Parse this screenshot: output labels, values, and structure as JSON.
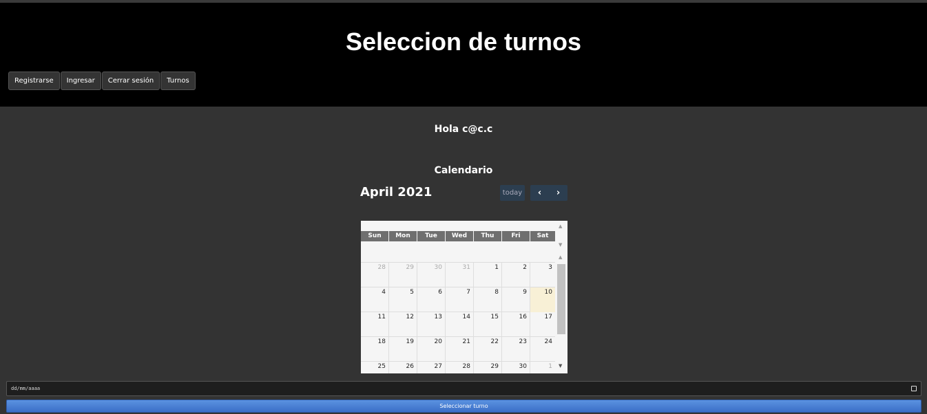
{
  "header": {
    "title": "Seleccion de turnos",
    "nav": [
      "Registrarse",
      "Ingresar",
      "Cerrar sesión",
      "Turnos"
    ]
  },
  "greeting": "Hola c@c.c",
  "calendar_heading": "Calendario",
  "calendar": {
    "month_title": "April 2021",
    "today_label": "today",
    "prev_icon": "chevron-left-icon",
    "next_icon": "chevron-right-icon",
    "weekdays": [
      "Sun",
      "Mon",
      "Tue",
      "Wed",
      "Thu",
      "Fri",
      "Sat"
    ],
    "weeks": [
      [
        "28",
        "29",
        "30",
        "31",
        "1",
        "2",
        "3"
      ],
      [
        "4",
        "5",
        "6",
        "7",
        "8",
        "9",
        "10"
      ],
      [
        "11",
        "12",
        "13",
        "14",
        "15",
        "16",
        "17"
      ],
      [
        "18",
        "19",
        "20",
        "21",
        "22",
        "23",
        "24"
      ],
      [
        "25",
        "26",
        "27",
        "28",
        "29",
        "30",
        "1"
      ]
    ],
    "today_date": "10",
    "colors": {
      "header_bg": "#6f6f6f",
      "today_bg": "#f8f0d6",
      "button_bg": "#2c3e50"
    }
  },
  "date_input": {
    "placeholder": "dd/mm/aaaa",
    "icon": "calendar-icon"
  },
  "submit_label": "Seleccionar turno"
}
